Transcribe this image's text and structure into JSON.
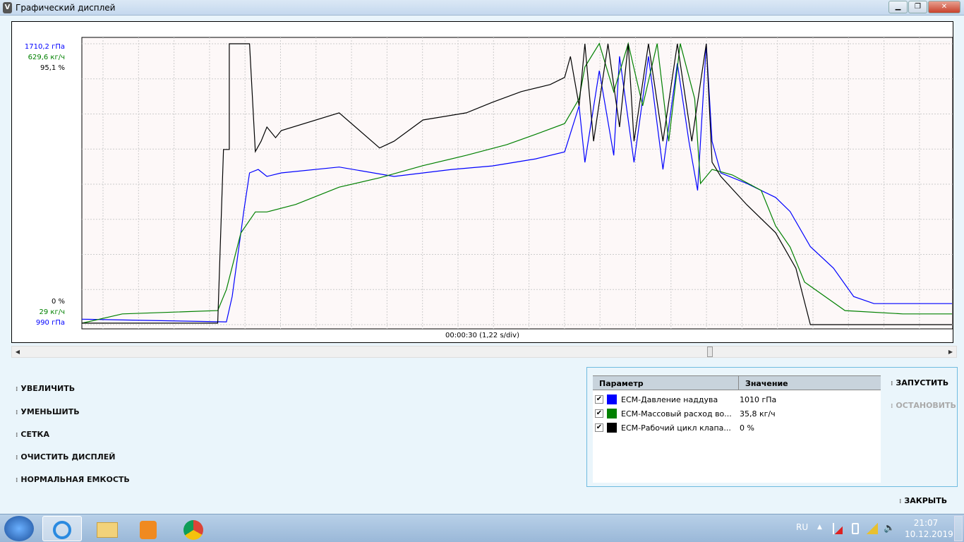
{
  "window": {
    "title": "Графический дисплей",
    "min": "▁",
    "max": "❐",
    "close": "✕",
    "icon_letter": "V"
  },
  "chart_data": {
    "type": "line",
    "xlabel": "00:00:30 (1,22 s/div)",
    "xlim": [
      0,
      30.1
    ],
    "axes": {
      "blue": {
        "top": "1710,2 гПа",
        "bottom": "990 гПа",
        "range": [
          990,
          1710.2
        ]
      },
      "green": {
        "top": "629,6 кг/ч",
        "bottom": "29 кг/ч",
        "range": [
          29,
          629.6
        ]
      },
      "black": {
        "top": "95,1 %",
        "bottom": "0 %",
        "range": [
          0,
          95.1
        ]
      }
    },
    "grid": true,
    "series": [
      {
        "name": "ECM-Давление наддува",
        "axis": "blue",
        "color": "#0000ff",
        "points": [
          [
            0,
            1004
          ],
          [
            5.0,
            997
          ],
          [
            5.2,
            1062
          ],
          [
            5.6,
            1280
          ],
          [
            5.8,
            1379
          ],
          [
            6.1,
            1388
          ],
          [
            6.4,
            1370
          ],
          [
            6.9,
            1379
          ],
          [
            8.9,
            1394
          ],
          [
            10.8,
            1370
          ],
          [
            12.8,
            1388
          ],
          [
            14.2,
            1397
          ],
          [
            15.7,
            1415
          ],
          [
            16.7,
            1433
          ],
          [
            17.2,
            1551
          ],
          [
            17.4,
            1406
          ],
          [
            17.9,
            1641
          ],
          [
            18.4,
            1424
          ],
          [
            18.6,
            1678
          ],
          [
            19.1,
            1406
          ],
          [
            19.6,
            1678
          ],
          [
            20.1,
            1388
          ],
          [
            20.6,
            1660
          ],
          [
            21.0,
            1460
          ],
          [
            21.3,
            1334
          ],
          [
            21.6,
            1710
          ],
          [
            21.8,
            1460
          ],
          [
            22.1,
            1379
          ],
          [
            23.0,
            1352
          ],
          [
            24.0,
            1316
          ],
          [
            24.5,
            1280
          ],
          [
            25.2,
            1190
          ],
          [
            26.0,
            1135
          ],
          [
            26.7,
            1062
          ],
          [
            27.4,
            1044
          ],
          [
            30.1,
            1044
          ]
        ]
      },
      {
        "name": "ECM-Массовый расход воздуха",
        "axis": "green",
        "color": "#008000",
        "points": [
          [
            0,
            32
          ],
          [
            1.4,
            52
          ],
          [
            4.7,
            59
          ],
          [
            5.0,
            104
          ],
          [
            5.5,
            225
          ],
          [
            6.0,
            270
          ],
          [
            6.4,
            270
          ],
          [
            7.4,
            286
          ],
          [
            8.9,
            323
          ],
          [
            10.3,
            343
          ],
          [
            11.8,
            369
          ],
          [
            13.3,
            391
          ],
          [
            14.7,
            414
          ],
          [
            15.7,
            436
          ],
          [
            16.7,
            459
          ],
          [
            17.2,
            512
          ],
          [
            17.4,
            580
          ],
          [
            17.9,
            630
          ],
          [
            18.4,
            527
          ],
          [
            18.9,
            630
          ],
          [
            19.4,
            497
          ],
          [
            19.9,
            630
          ],
          [
            20.3,
            421
          ],
          [
            20.7,
            630
          ],
          [
            21.2,
            512
          ],
          [
            21.4,
            331
          ],
          [
            21.8,
            361
          ],
          [
            22.5,
            349
          ],
          [
            23.5,
            316
          ],
          [
            24.0,
            240
          ],
          [
            24.5,
            195
          ],
          [
            25.0,
            120
          ],
          [
            26.4,
            59
          ],
          [
            28.4,
            52
          ],
          [
            30.1,
            52
          ]
        ]
      },
      {
        "name": "ECM-Рабочий цикл клапана",
        "axis": "black",
        "color": "#000000",
        "points": [
          [
            0,
            0.5
          ],
          [
            4.7,
            0.5
          ],
          [
            4.9,
            59.3
          ],
          [
            5.1,
            59.3
          ],
          [
            5.1,
            95.1
          ],
          [
            5.8,
            95.1
          ],
          [
            6.0,
            58.6
          ],
          [
            6.2,
            62.1
          ],
          [
            6.4,
            66.9
          ],
          [
            6.7,
            63.3
          ],
          [
            6.9,
            65.7
          ],
          [
            8.9,
            71.7
          ],
          [
            10.3,
            59.8
          ],
          [
            10.8,
            62.1
          ],
          [
            11.8,
            69.3
          ],
          [
            13.3,
            71.7
          ],
          [
            14.2,
            75.3
          ],
          [
            15.2,
            78.9
          ],
          [
            16.2,
            81.3
          ],
          [
            16.7,
            83.7
          ],
          [
            16.9,
            90.8
          ],
          [
            17.2,
            74.1
          ],
          [
            17.4,
            95.1
          ],
          [
            17.7,
            62.1
          ],
          [
            18.2,
            95.1
          ],
          [
            18.6,
            66.9
          ],
          [
            18.9,
            95.1
          ],
          [
            19.1,
            62.1
          ],
          [
            19.6,
            95.1
          ],
          [
            20.1,
            62.1
          ],
          [
            20.6,
            95.1
          ],
          [
            21.1,
            62.1
          ],
          [
            21.6,
            95.1
          ],
          [
            21.8,
            55
          ],
          [
            22.1,
            50.2
          ],
          [
            23.0,
            40.6
          ],
          [
            24.0,
            31.1
          ],
          [
            24.7,
            19.1
          ],
          [
            25.2,
            0
          ],
          [
            30.1,
            0
          ]
        ]
      }
    ]
  },
  "scroll": {
    "left": "◀",
    "right": "▶",
    "position_pct": 75
  },
  "menu": [
    "УВЕЛИЧИТЬ",
    "УМЕНЬШИТЬ",
    "СЕТКА",
    "ОЧИСТИТЬ ДИСПЛЕЙ",
    "НОРМАЛЬНАЯ ЕМКОСТЬ"
  ],
  "table": {
    "headers": [
      "Параметр",
      "Значение"
    ],
    "rows": [
      {
        "checked": "✔",
        "color": "#0000ff",
        "name": "ECM-Давление наддува",
        "value": "1010 гПа"
      },
      {
        "checked": "✔",
        "color": "#008000",
        "name": "ECM-Массовый расход во...",
        "value": "35,8 кг/ч"
      },
      {
        "checked": "✔",
        "color": "#000000",
        "name": "ECM-Рабочий цикл клапа...",
        "value": "0 %"
      }
    ]
  },
  "actions": {
    "start": "ЗАПУСТИТЬ",
    "stop": "ОСТАНОВИТЬ",
    "close": "ЗАКРЫТЬ"
  },
  "taskbar": {
    "lang": "RU",
    "time": "21:07",
    "date": "10.12.2019",
    "tray_up": "▲"
  }
}
